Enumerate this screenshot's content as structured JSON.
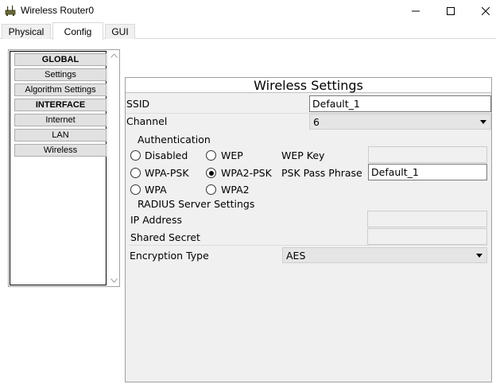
{
  "window": {
    "title": "Wireless Router0",
    "controls": [
      "minimize",
      "maximize",
      "close"
    ]
  },
  "tabs": [
    {
      "label": "Physical",
      "active": false
    },
    {
      "label": "Config",
      "active": true
    },
    {
      "label": "GUI",
      "active": false
    }
  ],
  "sidebar": {
    "items": [
      {
        "label": "GLOBAL",
        "header": true
      },
      {
        "label": "Settings",
        "header": false
      },
      {
        "label": "Algorithm Settings",
        "header": false
      },
      {
        "label": "INTERFACE",
        "header": true
      },
      {
        "label": "Internet",
        "header": false
      },
      {
        "label": "LAN",
        "header": false
      },
      {
        "label": "Wireless",
        "header": false
      }
    ]
  },
  "wireless": {
    "title": "Wireless Settings",
    "ssid_label": "SSID",
    "ssid_value": "Default_1",
    "channel_label": "Channel",
    "channel_value": "6",
    "auth": {
      "title": "Authentication",
      "options": {
        "disabled": "Disabled",
        "wep": "WEP",
        "wpa_psk": "WPA-PSK",
        "wpa2_psk": "WPA2-PSK",
        "wpa": "WPA",
        "wpa2": "WPA2"
      },
      "selected": "WPA2-PSK",
      "wep_key_label": "WEP Key",
      "wep_key_value": "",
      "psk_label": "PSK Pass Phrase",
      "psk_value": "Default_1"
    },
    "radius": {
      "title": "RADIUS Server Settings",
      "ip_label": "IP Address",
      "ip_value": "",
      "secret_label": "Shared Secret",
      "secret_value": ""
    },
    "encryption_label": "Encryption Type",
    "encryption_value": "AES"
  }
}
